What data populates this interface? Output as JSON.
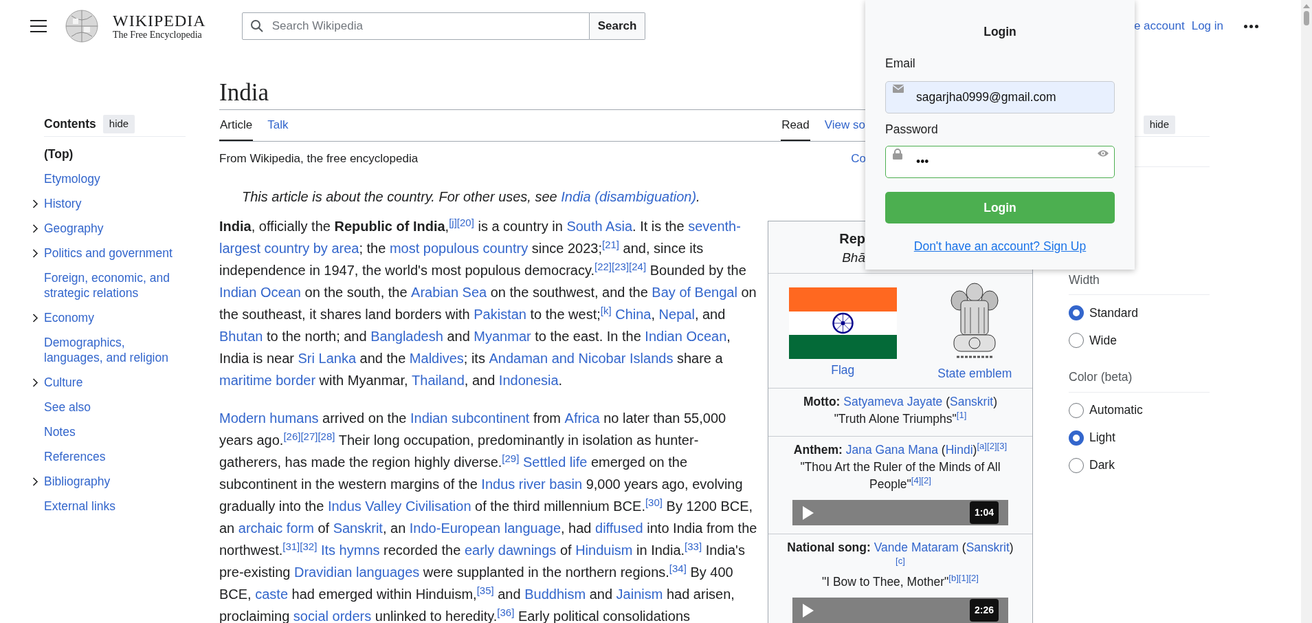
{
  "header": {
    "wordmark": "WIKIPEDIA",
    "tagline": "The Free Encyclopedia",
    "search_placeholder": "Search Wikipedia",
    "search_button": "Search",
    "links": [
      "e account",
      "Log in"
    ]
  },
  "sidebar": {
    "title": "Contents",
    "hide_button": "hide",
    "items": [
      {
        "label": "(Top)",
        "selected": true,
        "collapsible": false
      },
      {
        "label": "Etymology",
        "selected": false,
        "collapsible": false
      },
      {
        "label": "History",
        "selected": false,
        "collapsible": true
      },
      {
        "label": "Geography",
        "selected": false,
        "collapsible": true
      },
      {
        "label": "Politics and government",
        "selected": false,
        "collapsible": true
      },
      {
        "label": "Foreign, economic, and strategic relations",
        "selected": false,
        "collapsible": false
      },
      {
        "label": "Economy",
        "selected": false,
        "collapsible": true
      },
      {
        "label": "Demographics, languages, and religion",
        "selected": false,
        "collapsible": false
      },
      {
        "label": "Culture",
        "selected": false,
        "collapsible": true
      },
      {
        "label": "See also",
        "selected": false,
        "collapsible": false
      },
      {
        "label": "Notes",
        "selected": false,
        "collapsible": false
      },
      {
        "label": "References",
        "selected": false,
        "collapsible": false
      },
      {
        "label": "Bibliography",
        "selected": false,
        "collapsible": true
      },
      {
        "label": "External links",
        "selected": false,
        "collapsible": false
      }
    ]
  },
  "article": {
    "title": "India",
    "tabs": [
      {
        "label": "Article",
        "selected": true
      },
      {
        "label": "Talk",
        "selected": false
      }
    ],
    "view_tabs": [
      {
        "label": "Read",
        "selected": true
      },
      {
        "label": "View so",
        "selected": false
      }
    ],
    "tagline": "From Wikipedia, the free encyclopedia",
    "coordinates": "Co",
    "hatnote": [
      {
        "kind": "text",
        "text": "This article is about the country. For other uses, see "
      },
      {
        "kind": "link",
        "text": "India (disambiguation)"
      },
      {
        "kind": "text",
        "text": "."
      }
    ],
    "paragraphs": [
      [
        {
          "kind": "bold",
          "text": "India"
        },
        {
          "kind": "text",
          "text": ", officially the "
        },
        {
          "kind": "bold",
          "text": "Republic of India"
        },
        {
          "kind": "text",
          "text": ","
        },
        {
          "kind": "ref",
          "text": "[j]"
        },
        {
          "kind": "ref",
          "text": "[20]"
        },
        {
          "kind": "text",
          "text": " is a country in "
        },
        {
          "kind": "link",
          "text": "South Asia"
        },
        {
          "kind": "text",
          "text": ". It is the "
        },
        {
          "kind": "link",
          "text": "seventh-"
        },
        {
          "kind": "link",
          "text": "largest country by area"
        },
        {
          "kind": "text",
          "text": "; the "
        },
        {
          "kind": "link",
          "text": "most populous country"
        },
        {
          "kind": "text",
          "text": " since 2023;"
        },
        {
          "kind": "ref",
          "text": "[21]"
        },
        {
          "kind": "text",
          "text": " and, since its independence in 1947, the world's most populous democracy."
        },
        {
          "kind": "ref",
          "text": "[22]"
        },
        {
          "kind": "ref",
          "text": "[23]"
        },
        {
          "kind": "ref",
          "text": "[24]"
        },
        {
          "kind": "text",
          "text": " Bounded by the "
        },
        {
          "kind": "link",
          "text": "Indian Ocean"
        },
        {
          "kind": "text",
          "text": " on the south, the "
        },
        {
          "kind": "link",
          "text": "Arabian Sea"
        },
        {
          "kind": "text",
          "text": " on the southwest, and the "
        },
        {
          "kind": "link",
          "text": "Bay of Bengal"
        },
        {
          "kind": "text",
          "text": " on the southeast, it shares land borders with "
        },
        {
          "kind": "link",
          "text": "Pakistan"
        },
        {
          "kind": "text",
          "text": " to the west;"
        },
        {
          "kind": "ref",
          "text": "[k]"
        },
        {
          "kind": "link",
          "text": "China",
          "space_before": true
        },
        {
          "kind": "text",
          "text": ", "
        },
        {
          "kind": "link",
          "text": "Nepal"
        },
        {
          "kind": "text",
          "text": ", and "
        },
        {
          "kind": "link",
          "text": "Bhutan"
        },
        {
          "kind": "text",
          "text": " to the north; and "
        },
        {
          "kind": "link",
          "text": "Bangladesh"
        },
        {
          "kind": "text",
          "text": " and "
        },
        {
          "kind": "link",
          "text": "Myanmar"
        },
        {
          "kind": "text",
          "text": " to the east. In the "
        },
        {
          "kind": "link",
          "text": "Indian Ocean"
        },
        {
          "kind": "text",
          "text": ", India is near "
        },
        {
          "kind": "link",
          "text": "Sri Lanka"
        },
        {
          "kind": "text",
          "text": " and the "
        },
        {
          "kind": "link",
          "text": "Maldives"
        },
        {
          "kind": "text",
          "text": "; its "
        },
        {
          "kind": "link",
          "text": "Andaman and Nicobar Islands"
        },
        {
          "kind": "text",
          "text": " share a "
        },
        {
          "kind": "link",
          "text": "maritime border"
        },
        {
          "kind": "text",
          "text": " with Myanmar, "
        },
        {
          "kind": "link",
          "text": "Thailand"
        },
        {
          "kind": "text",
          "text": ", and "
        },
        {
          "kind": "link",
          "text": "Indonesia"
        },
        {
          "kind": "text",
          "text": "."
        }
      ],
      [
        {
          "kind": "link",
          "text": "Modern humans"
        },
        {
          "kind": "text",
          "text": " arrived on the "
        },
        {
          "kind": "link",
          "text": "Indian subcontinent"
        },
        {
          "kind": "text",
          "text": " from "
        },
        {
          "kind": "link",
          "text": "Africa"
        },
        {
          "kind": "text",
          "text": " no later than 55,000 years ago."
        },
        {
          "kind": "ref",
          "text": "[26]"
        },
        {
          "kind": "ref",
          "text": "[27]"
        },
        {
          "kind": "ref",
          "text": "[28]"
        },
        {
          "kind": "text",
          "text": " Their long occupation, predominantly in isolation as hunter-gatherers, has made the region highly diverse."
        },
        {
          "kind": "ref",
          "text": "[29]"
        },
        {
          "kind": "link",
          "text": "Settled life",
          "space_before": true
        },
        {
          "kind": "text",
          "text": " emerged on the subcontinent in the western margins of the "
        },
        {
          "kind": "link",
          "text": "Indus river basin"
        },
        {
          "kind": "text",
          "text": " 9,000 years ago, evolving gradually into the "
        },
        {
          "kind": "link",
          "text": "Indus Valley Civilisation"
        },
        {
          "kind": "text",
          "text": " of the third millennium BCE."
        },
        {
          "kind": "ref",
          "text": "[30]"
        },
        {
          "kind": "text",
          "text": " By 1200 BCE, an "
        },
        {
          "kind": "link",
          "text": "archaic form"
        },
        {
          "kind": "text",
          "text": " of "
        },
        {
          "kind": "link",
          "text": "Sanskrit"
        },
        {
          "kind": "text",
          "text": ", an "
        },
        {
          "kind": "link",
          "text": "Indo-European language"
        },
        {
          "kind": "text",
          "text": ", had "
        },
        {
          "kind": "link",
          "text": "diffused"
        },
        {
          "kind": "text",
          "text": " into India from the northwest."
        },
        {
          "kind": "ref",
          "text": "[31]"
        },
        {
          "kind": "ref",
          "text": "[32]"
        },
        {
          "kind": "link",
          "text": "Its hymns",
          "space_before": true
        },
        {
          "kind": "text",
          "text": " recorded the "
        },
        {
          "kind": "link",
          "text": "early dawnings"
        },
        {
          "kind": "text",
          "text": " of "
        },
        {
          "kind": "link",
          "text": "Hinduism"
        },
        {
          "kind": "text",
          "text": " in India."
        },
        {
          "kind": "ref",
          "text": "[33]"
        },
        {
          "kind": "text",
          "text": " India's pre-existing "
        },
        {
          "kind": "link",
          "text": "Dravidian languages"
        },
        {
          "kind": "text",
          "text": " were supplanted in the northern regions."
        },
        {
          "kind": "ref",
          "text": "[34]"
        },
        {
          "kind": "text",
          "text": " By 400 BCE, "
        },
        {
          "kind": "link",
          "text": "caste"
        },
        {
          "kind": "text",
          "text": " had emerged within Hinduism,"
        },
        {
          "kind": "ref",
          "text": "[35]"
        },
        {
          "kind": "text",
          "text": " and "
        },
        {
          "kind": "link",
          "text": "Buddhism"
        },
        {
          "kind": "text",
          "text": " and "
        },
        {
          "kind": "link",
          "text": "Jainism"
        },
        {
          "kind": "text",
          "text": " had arisen, proclaiming "
        },
        {
          "kind": "link",
          "text": "social orders"
        },
        {
          "kind": "text",
          "text": " unlinked to heredity."
        },
        {
          "kind": "ref",
          "text": "[36]"
        },
        {
          "kind": "text",
          "text": " Early political consolidations"
        }
      ]
    ]
  },
  "infobox": {
    "title": "Rep",
    "subtitle": "Bhā",
    "images": [
      {
        "kind": "flag",
        "caption": "Flag"
      },
      {
        "kind": "emblem",
        "caption": "State emblem"
      }
    ],
    "rows": [
      {
        "lines": [
          [
            {
              "kind": "bold",
              "text": "Motto:"
            },
            {
              "kind": "link",
              "text": "Satyameva Jayate",
              "space_before": true
            },
            {
              "kind": "text",
              "text": " ("
            },
            {
              "kind": "link",
              "text": "Sanskrit"
            },
            {
              "kind": "text",
              "text": ")"
            }
          ],
          [
            {
              "kind": "text",
              "text": "\"Truth Alone Triumphs\""
            },
            {
              "kind": "ref",
              "text": "[1]"
            }
          ]
        ]
      },
      {
        "lines": [
          [
            {
              "kind": "bold",
              "text": "Anthem:"
            },
            {
              "kind": "link",
              "text": "Jana Gana Mana",
              "space_before": true
            },
            {
              "kind": "text",
              "text": " ("
            },
            {
              "kind": "link",
              "text": "Hindi"
            },
            {
              "kind": "text",
              "text": ")"
            },
            {
              "kind": "ref",
              "text": "[a]"
            },
            {
              "kind": "ref",
              "text": "[2]"
            },
            {
              "kind": "ref",
              "text": "[3]"
            }
          ],
          [
            {
              "kind": "text",
              "text": "\"Thou Art the Ruler of the Minds of All People\""
            },
            {
              "kind": "ref",
              "text": "[4]"
            },
            {
              "kind": "ref",
              "text": "[2]"
            }
          ]
        ],
        "audio": {
          "time": "1:04"
        }
      },
      {
        "lines": [
          [
            {
              "kind": "bold",
              "text": "National song:"
            },
            {
              "kind": "link",
              "text": "Vande Mataram",
              "space_before": true
            },
            {
              "kind": "text",
              "text": " ("
            },
            {
              "kind": "link",
              "text": "Sanskrit"
            },
            {
              "kind": "text",
              "text": ")"
            },
            {
              "kind": "ref",
              "text": "[c]"
            }
          ],
          [
            {
              "kind": "text",
              "text": "\"I Bow to Thee, Mother\""
            },
            {
              "kind": "ref",
              "text": "[b]"
            },
            {
              "kind": "ref",
              "text": "[1]"
            },
            {
              "kind": "ref",
              "text": "[2]"
            }
          ]
        ],
        "audio": {
          "time": "2:26"
        }
      }
    ]
  },
  "appearance": {
    "hide_button": "hide",
    "groups": [
      {
        "label": "Width",
        "options": [
          {
            "label": "Standard",
            "selected": true
          },
          {
            "label": "Wide",
            "selected": false
          }
        ]
      },
      {
        "label": "Color (beta)",
        "options": [
          {
            "label": "Automatic",
            "selected": false
          },
          {
            "label": "Light",
            "selected": true
          },
          {
            "label": "Dark",
            "selected": false
          }
        ]
      }
    ]
  },
  "login": {
    "title": "Login",
    "email_label": "Email",
    "email_value": "sagarjha0999@gmail.com",
    "password_label": "Password",
    "password_value": "•••",
    "button": "Login",
    "signup_link": "Don't have an account? Sign Up"
  }
}
